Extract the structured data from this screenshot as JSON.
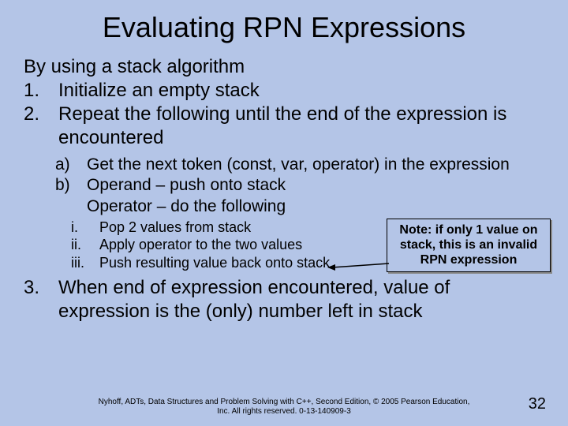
{
  "title": "Evaluating RPN Expressions",
  "intro": "By using a stack algorithm",
  "steps": {
    "m1": "1.",
    "t1": "Initialize an empty stack",
    "m2": "2.",
    "t2": "Repeat the following until the end of the expression is encountered",
    "m3": "3.",
    "t3": "When end of expression encountered, value of expression is the (only) number left in stack"
  },
  "sub": {
    "ma": "a)",
    "ta": "Get the next token (const, var, operator) in the expression",
    "mb": "b)",
    "tb1": "Operand – push onto stack",
    "tb2": "Operator – do the following"
  },
  "roman": {
    "m1": "i.",
    "t1": "Pop 2 values from stack",
    "m2": "ii.",
    "t2": "Apply operator to the two values",
    "m3": "iii.",
    "t3": "Push resulting value back onto stack"
  },
  "note": "Note: if only 1 value on stack, this is an invalid RPN expression",
  "footer": "Nyhoff, ADTs, Data Structures and Problem Solving with C++, Second Edition, © 2005 Pearson Education, Inc. All rights reserved. 0-13-140909-3",
  "page": "32"
}
